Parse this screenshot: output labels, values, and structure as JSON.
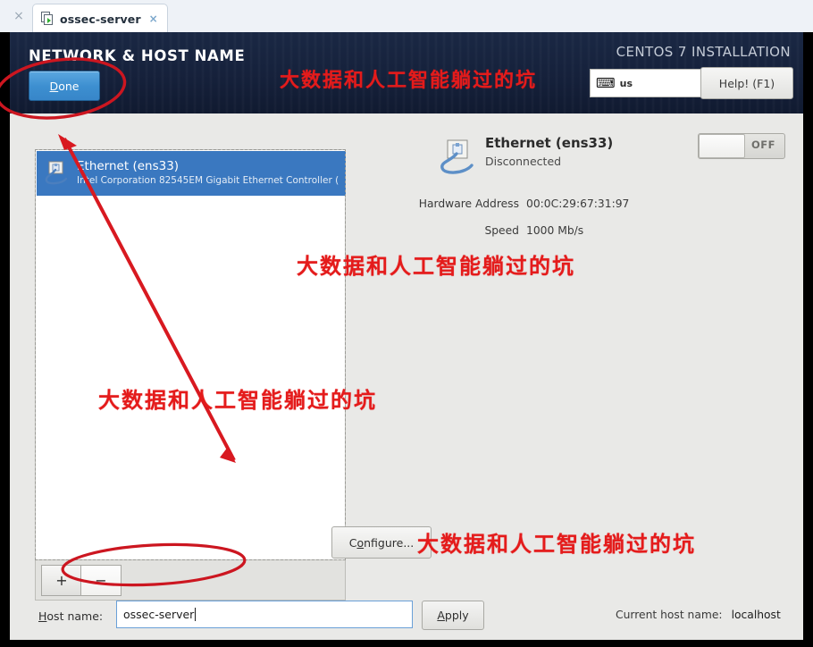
{
  "tab": {
    "left_close": "×",
    "icon_name": "vm-window-icon",
    "label": "ossec-server",
    "close": "×"
  },
  "header": {
    "title": "NETWORK & HOST NAME",
    "done_label_pre": "D",
    "done_label_post": "one",
    "installer_title": "CENTOS 7 INSTALLATION",
    "keyboard_icon": "⌨",
    "keyboard_layout": "us",
    "help_label": "Help! (F1)"
  },
  "device_list": {
    "items": [
      {
        "title": "Ethernet (ens33)",
        "subtitle": "Intel Corporation 82545EM Gigabit Ethernet Controller (",
        "icon_name": "ethernet-icon",
        "selected": true
      }
    ],
    "add_label": "+",
    "remove_label": "−"
  },
  "detail": {
    "icon_name": "ethernet-icon",
    "name": "Ethernet (ens33)",
    "status": "Disconnected",
    "toggle_state": "OFF",
    "fields": [
      {
        "key": "Hardware Address",
        "value": "00:0C:29:67:31:97"
      },
      {
        "key": "Speed",
        "value": "1000 Mb/s"
      }
    ],
    "configure_pre": "C",
    "configure_mid": "o",
    "configure_post": "nfigure..."
  },
  "host": {
    "label_pre": "H",
    "label_post": "ost name:",
    "value": "ossec-server",
    "placeholder": "",
    "apply_pre": "A",
    "apply_post": "pply",
    "current_label": "Current host name:",
    "current_value": "localhost"
  },
  "annotations": {
    "watermark": "大数据和人工智能躺过的坑",
    "color": "#e41b1b"
  },
  "colors": {
    "header_bg": "#17233c",
    "accent_blue": "#3a78c0",
    "panel_bg": "#e9e9e7",
    "annotation_red": "#e41b1b"
  }
}
